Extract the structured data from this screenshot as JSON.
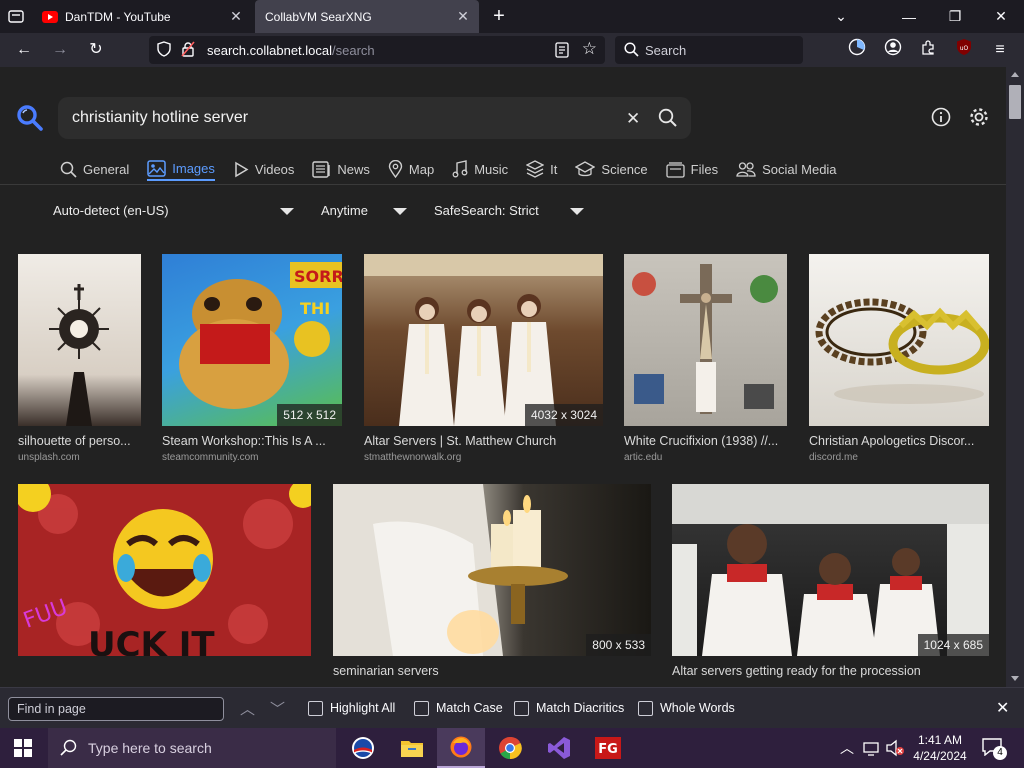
{
  "browser": {
    "tabs": [
      {
        "title": "DanTDM - YouTube",
        "active": false
      },
      {
        "title": "CollabVM SearXNG",
        "active": true
      }
    ],
    "url_host": "search.collabnet.local",
    "url_path": "/search",
    "search_placeholder": "Search"
  },
  "search": {
    "query": "christianity hotline server",
    "categories": [
      {
        "label": "General",
        "icon": "search-icon",
        "active": false
      },
      {
        "label": "Images",
        "icon": "image-icon",
        "active": true
      },
      {
        "label": "Videos",
        "icon": "play-icon",
        "active": false
      },
      {
        "label": "News",
        "icon": "newspaper-icon",
        "active": false
      },
      {
        "label": "Map",
        "icon": "map-pin-icon",
        "active": false
      },
      {
        "label": "Music",
        "icon": "music-icon",
        "active": false
      },
      {
        "label": "It",
        "icon": "layers-icon",
        "active": false
      },
      {
        "label": "Science",
        "icon": "science-icon",
        "active": false
      },
      {
        "label": "Files",
        "icon": "files-icon",
        "active": false
      },
      {
        "label": "Social Media",
        "icon": "people-icon",
        "active": false
      }
    ],
    "filters": {
      "language": "Auto-detect (en-US)",
      "time": "Anytime",
      "safesearch": "SafeSearch: Strict"
    }
  },
  "results": [
    {
      "title": "silhouette of perso...",
      "source": "unsplash.com",
      "resolution": ""
    },
    {
      "title": "Steam Workshop::This Is A ...",
      "source": "steamcommunity.com",
      "resolution": "512 x 512"
    },
    {
      "title": "Altar Servers | St. Matthew Church",
      "source": "stmatthewnorwalk.org",
      "resolution": "4032 x 3024"
    },
    {
      "title": "White Crucifixion (1938) //...",
      "source": "artic.edu",
      "resolution": ""
    },
    {
      "title": "Christian Apologetics Discor...",
      "source": "discord.me",
      "resolution": ""
    },
    {
      "title": "",
      "source": "",
      "resolution": ""
    },
    {
      "title": "seminarian servers",
      "source": "",
      "resolution": "800 x 533"
    },
    {
      "title": "Altar servers getting ready for the procession",
      "source": "",
      "resolution": "1024 x 685"
    }
  ],
  "findbar": {
    "placeholder": "Find in page",
    "options": [
      "Highlight All",
      "Match Case",
      "Match Diacritics",
      "Whole Words"
    ]
  },
  "taskbar": {
    "search_placeholder": "Type here to search",
    "time": "1:41 AM",
    "date": "4/24/2024",
    "notification_count": "4"
  },
  "colors": {
    "accent": "#5c9cff",
    "taskbar": "#2e1f3d"
  }
}
